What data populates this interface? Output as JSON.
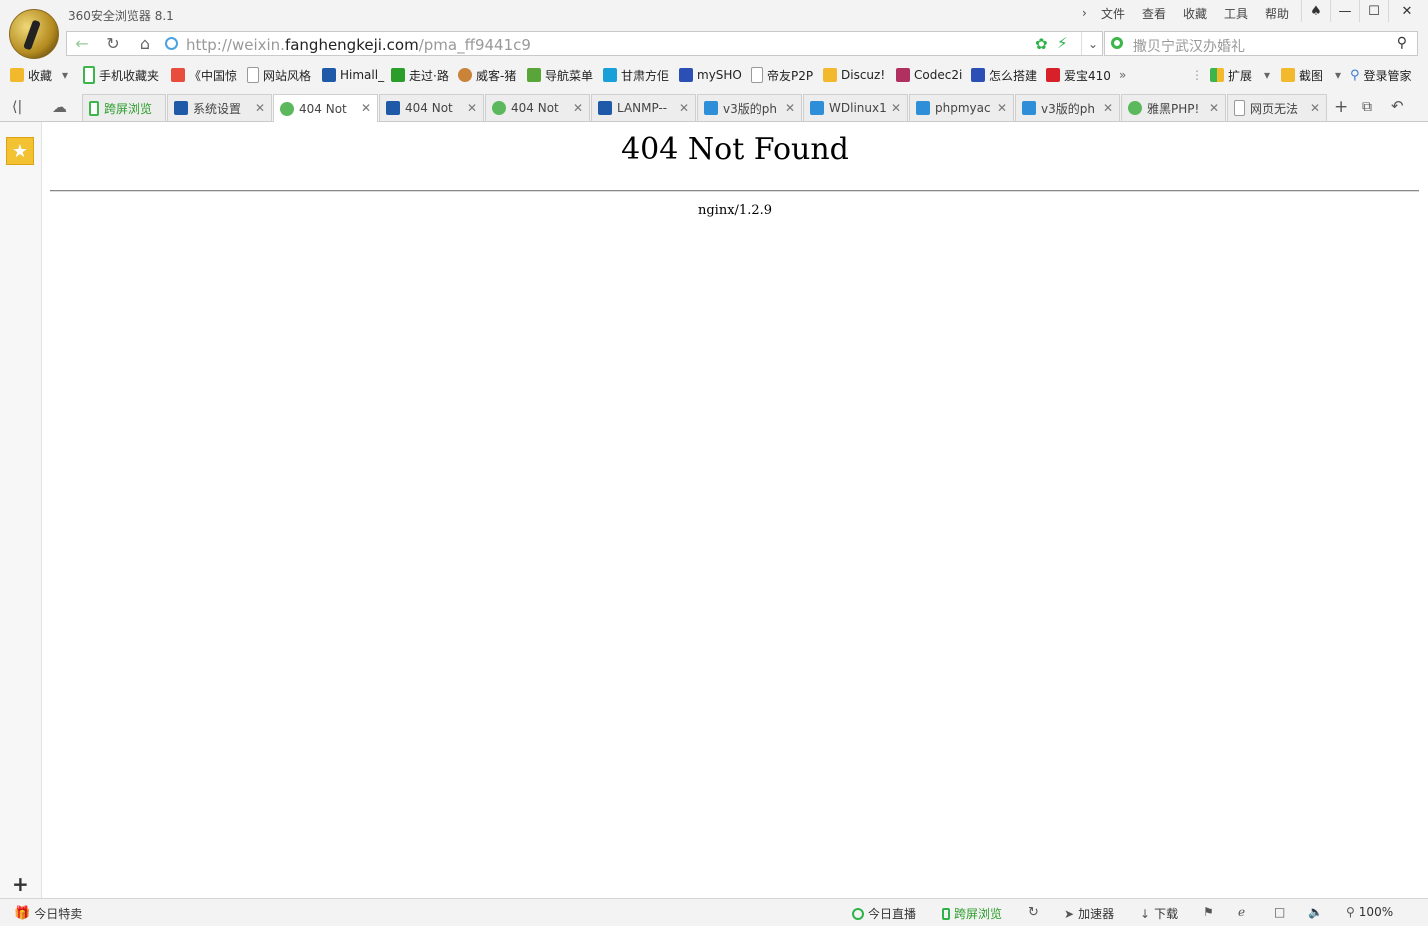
{
  "app": {
    "title": "360安全浏览器 8.1"
  },
  "menu": [
    "文件",
    "查看",
    "收藏",
    "工具",
    "帮助"
  ],
  "address": {
    "prefix": "http://weixin.",
    "domain": "fanghengkeji.com",
    "path": "/pma_ff9441c9"
  },
  "search": {
    "placeholder": "撒贝宁武汉办婚礼"
  },
  "bookmarks": {
    "favorites_label": "收藏",
    "items": [
      "手机收藏夹",
      "《中国惊",
      "网站风格",
      "Himall_",
      "走过·路",
      "威客-猪",
      "导航菜单",
      "甘肃方佢",
      "mySHO",
      "帝友P2P",
      "Discuz!",
      "Codec2i",
      "怎么搭建",
      "爱宝410"
    ],
    "extensions_label": "扩展",
    "screenshot_label": "截图",
    "login_label": "登录管家"
  },
  "tabs": [
    {
      "label": "跨屏浏览",
      "icon": "phone-icon"
    },
    {
      "label": "系统设置",
      "icon": "wdcp-icon"
    },
    {
      "label": "404 Not",
      "icon": "wechat-icon"
    },
    {
      "label": "404 Not",
      "icon": "wdcp-icon"
    },
    {
      "label": "404 Not",
      "icon": "wechat-icon"
    },
    {
      "label": "LANMP--",
      "icon": "wdcp-icon"
    },
    {
      "label": "v3版的ph",
      "icon": "wd-icon"
    },
    {
      "label": "WDlinux1",
      "icon": "wd-icon"
    },
    {
      "label": "phpmyac",
      "icon": "wd-icon"
    },
    {
      "label": "v3版的ph",
      "icon": "wd-icon"
    },
    {
      "label": "雅黑PHP!",
      "icon": "wechat-icon"
    },
    {
      "label": "网页无法",
      "icon": "page-icon"
    }
  ],
  "page": {
    "heading": "404 Not Found",
    "server": "nginx/1.2.9"
  },
  "statusbar": {
    "deals": "今日特卖",
    "live": "今日直播",
    "crossscreen": "跨屏浏览",
    "accelerator": "加速器",
    "download": "下载",
    "zoom": "100%"
  }
}
